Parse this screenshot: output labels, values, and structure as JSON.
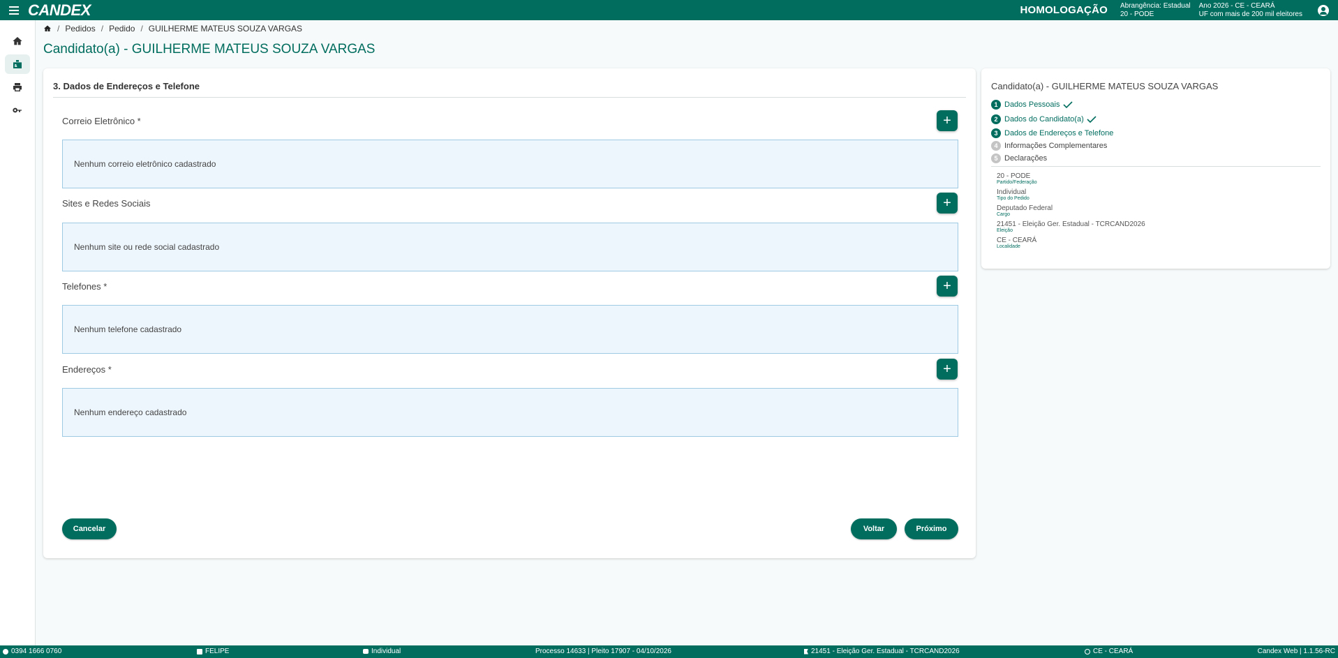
{
  "topbar": {
    "logo": "CANDEX",
    "environment": "HOMOLOGAÇÃO",
    "abrangencia": "Abrangência: Estadual",
    "partido": "20 - PODE",
    "ano": "Ano 2026 - CE - CEARÁ",
    "uf": "UF com mais de 200 mil eleitores",
    "icons": [
      "menu-icon",
      "user-account-icon"
    ]
  },
  "rail": {
    "items": [
      {
        "name": "home",
        "icon": "home-icon"
      },
      {
        "name": "candidate",
        "icon": "badge-icon"
      },
      {
        "name": "print",
        "icon": "printer-icon"
      },
      {
        "name": "key",
        "icon": "key-icon"
      }
    ]
  },
  "breadcrumb": {
    "items": [
      "Pedidos",
      "Pedido",
      "GUILHERME MATEUS SOUZA VARGAS"
    ]
  },
  "page": {
    "title": "Candidato(a) - GUILHERME MATEUS SOUZA VARGAS"
  },
  "form": {
    "section_title": "3. Dados de Endereços e Telefone",
    "groups": [
      {
        "label": "Correio Eletrônico *",
        "empty": "Nenhum correio eletrônico cadastrado"
      },
      {
        "label": "Sites e Redes Sociais",
        "empty": "Nenhum site ou rede social cadastrado"
      },
      {
        "label": "Telefones *",
        "empty": "Nenhum telefone cadastrado"
      },
      {
        "label": "Endereços *",
        "empty": "Nenhum endereço cadastrado"
      }
    ],
    "add_label": "+",
    "cancel_label": "Cancelar",
    "back_label": "Voltar",
    "next_label": "Próximo"
  },
  "summary": {
    "title": "Candidato(a) - GUILHERME MATEUS SOUZA VARGAS",
    "steps": [
      {
        "num": "1",
        "label": "Dados Pessoais",
        "status": "done"
      },
      {
        "num": "2",
        "label": "Dados do Candidato(a)",
        "status": "done"
      },
      {
        "num": "3",
        "label": "Dados de Endereços e Telefone",
        "status": "current"
      },
      {
        "num": "4",
        "label": "Informações Complementares",
        "status": "pending"
      },
      {
        "num": "5",
        "label": "Declarações",
        "status": "pending"
      }
    ],
    "info": [
      {
        "value": "20 - PODE",
        "key": "Partido/Federação"
      },
      {
        "value": "Individual",
        "key": "Tipo do Pedido"
      },
      {
        "value": "Deputado Federal",
        "key": "Cargo"
      },
      {
        "value": "21451 - Eleição Ger. Estadual - TCRCAND2026",
        "key": "Eleição"
      },
      {
        "value": "CE - CEARÁ",
        "key": "Localidade"
      }
    ]
  },
  "footer": {
    "phone": "0394 1666 0760",
    "user": "FELIPE",
    "tipo": "Individual",
    "processo": "Processo 14633 | Pleito 17907 - 04/10/2026",
    "eleicao": "21451 - Eleição Ger. Estadual - TCRCAND2026",
    "uf": "CE - CEARÁ",
    "version": "Candex Web | 1.1.56-RC"
  },
  "colors": {
    "primary": "#006d5f",
    "empty_box_bg": "#eef6fd",
    "empty_box_border": "#9fcae3",
    "pending_step": "#c4c4c4"
  }
}
